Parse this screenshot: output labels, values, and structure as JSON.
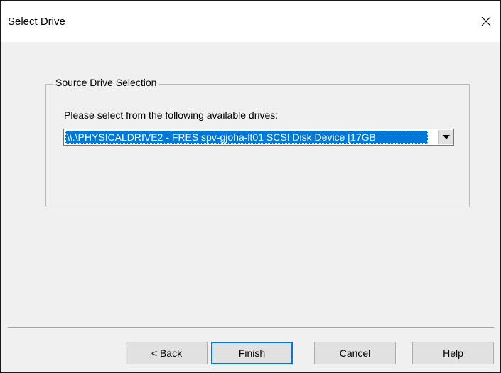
{
  "window": {
    "title": "Select Drive",
    "close_icon": "close-icon"
  },
  "source_group": {
    "legend": "Source Drive Selection",
    "prompt": "Please select from the following available drives:",
    "drive_select": {
      "selected_value": "\\\\.\\PHYSICALDRIVE2 - FRES spv-gjoha-lt01 SCSI Disk Device [17GB",
      "arrow_icon": "chevron-down-icon"
    }
  },
  "buttons": {
    "back": "< Back",
    "finish": "Finish",
    "cancel": "Cancel",
    "help": "Help"
  },
  "colors": {
    "selection": "#0078d7",
    "dialog_bg": "#f0f0f0",
    "button_bg": "#e1e1e1"
  }
}
